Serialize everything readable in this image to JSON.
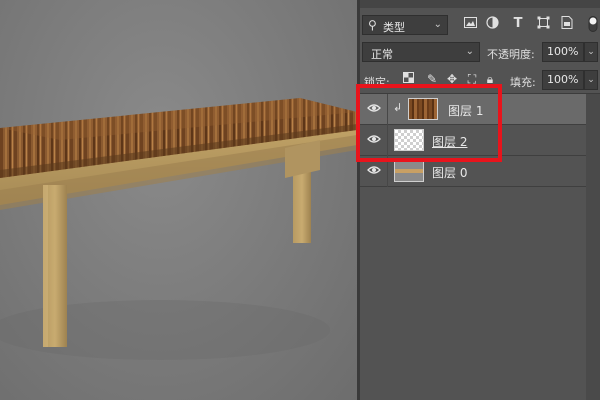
{
  "layers_panel": {
    "filter": {
      "label": "类型",
      "icon": "search-icon"
    },
    "filter_icons": [
      "image-filter-icon",
      "adjustment-filter-icon",
      "type-filter-icon",
      "shape-filter-icon",
      "smart-object-filter-icon",
      "filter-toggle-icon"
    ],
    "blend_mode": "正常",
    "opacity_label": "不透明度:",
    "opacity_value": "100%",
    "lock_label": "锁定:",
    "fill_label": "填充:",
    "fill_value": "100%",
    "layers": [
      {
        "name": "图层 1",
        "visible": true,
        "selected": true,
        "clipped": true,
        "thumbnail": "wood-texture"
      },
      {
        "name": "图层 2",
        "visible": true,
        "selected": false,
        "clipped": false,
        "thumbnail": "transparent"
      },
      {
        "name": "图层 0",
        "visible": true,
        "selected": false,
        "clipped": false,
        "thumbnail": "table"
      }
    ]
  },
  "colors": {
    "panel_bg": "#535353",
    "selected_layer_bg": "#6a6a6a",
    "highlight_box": "#e8141c",
    "canvas_bg": "#7d7d7d"
  }
}
